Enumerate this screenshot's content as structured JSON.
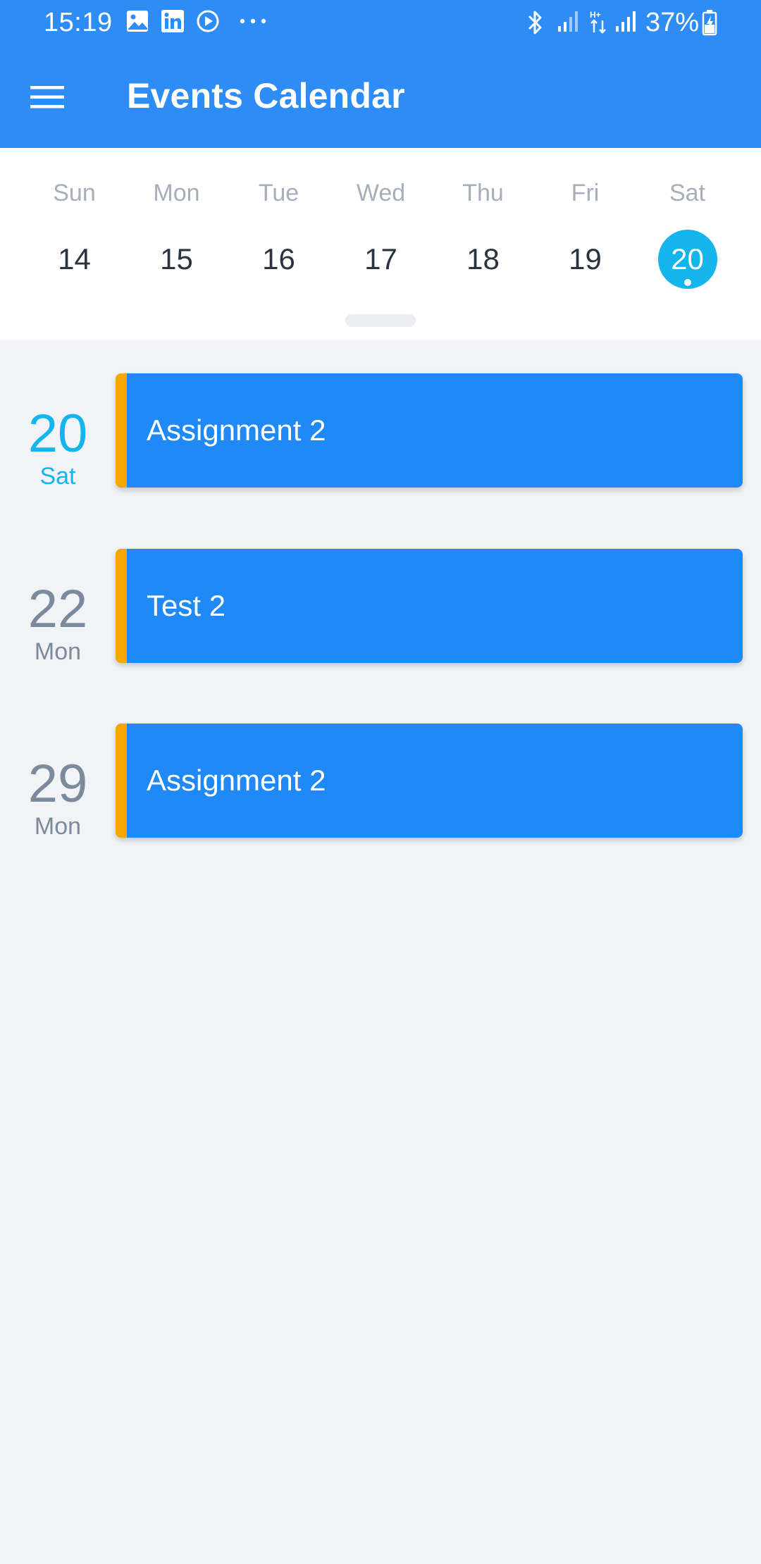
{
  "status_bar": {
    "time": "15:19",
    "left_icons": [
      "gallery-icon",
      "linkedin-icon",
      "play-icon",
      "more-dots-icon"
    ],
    "right_icons": [
      "bluetooth-icon",
      "signal-icon",
      "data-arrows-icon",
      "signal-icon",
      "battery-icon"
    ],
    "battery": "37%"
  },
  "app_bar": {
    "title": "Events Calendar",
    "menu_icon": "hamburger-menu-icon",
    "background": "#2D8CF5"
  },
  "week": {
    "days": [
      {
        "name": "Sun",
        "date": "14",
        "selected": false
      },
      {
        "name": "Mon",
        "date": "15",
        "selected": false
      },
      {
        "name": "Tue",
        "date": "16",
        "selected": false
      },
      {
        "name": "Wed",
        "date": "17",
        "selected": false
      },
      {
        "name": "Thu",
        "date": "18",
        "selected": false
      },
      {
        "name": "Fri",
        "date": "19",
        "selected": false
      },
      {
        "name": "Sat",
        "date": "20",
        "selected": true
      }
    ],
    "selected_color": "#14B4EC"
  },
  "agenda": [
    {
      "date": "20",
      "day": "Sat",
      "today": true,
      "title": "Assignment 2"
    },
    {
      "date": "22",
      "day": "Mon",
      "today": false,
      "title": "Test 2"
    },
    {
      "date": "29",
      "day": "Mon",
      "today": false,
      "title": "Assignment 2"
    }
  ],
  "colors": {
    "event_card": "#2089F8",
    "event_accent": "#F7A600",
    "background": "#F1F3F6"
  }
}
